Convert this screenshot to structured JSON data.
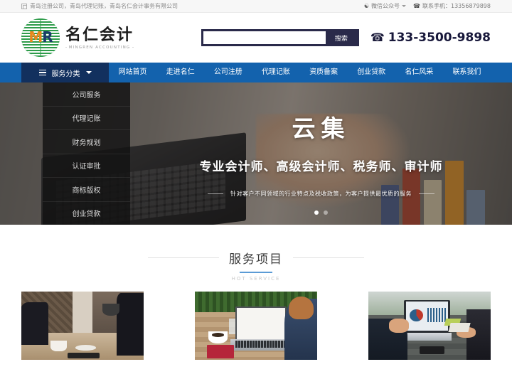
{
  "topbar": {
    "home_icon": "home-icon",
    "breadcrumb": "青岛注册公司，青岛代理记账，青岛名仁会计事务有限公司",
    "wechat_icon": "wechat-icon",
    "wechat_label": "微信公众号",
    "phone_icon": "phone-icon",
    "phone_label": "联系手机：13356879898"
  },
  "header": {
    "logo_mark_m": "M",
    "logo_mark_r": "R",
    "brand_cn": "名仁会计",
    "brand_en": "MINGREN ACCOUNTING",
    "search_value": "",
    "search_placeholder": "",
    "search_button": "搜索",
    "tel_icon": "telephone-icon",
    "tel_number": "133-3500-9898"
  },
  "nav": {
    "category_label": "服务分类",
    "menu_icon": "hamburger-icon",
    "caret_icon": "chevron-down-icon",
    "items": [
      {
        "label": "网站首页"
      },
      {
        "label": "走进名仁"
      },
      {
        "label": "公司注册"
      },
      {
        "label": "代理记账"
      },
      {
        "label": "资质备案"
      },
      {
        "label": "创业贷款"
      },
      {
        "label": "名仁风采"
      },
      {
        "label": "联系我们"
      }
    ]
  },
  "sidemenu": {
    "items": [
      {
        "label": "公司服务"
      },
      {
        "label": "代理记账"
      },
      {
        "label": "财务规划"
      },
      {
        "label": "认证审批"
      },
      {
        "label": "商标版权"
      },
      {
        "label": "创业贷款"
      }
    ]
  },
  "banner": {
    "title": "云集",
    "subtitle": "专业会计师、高级会计师、税务师、审计师",
    "description": "针对客户不同领域的行业特点及税收政策，为客户提供最优质的服务",
    "slides": 2,
    "active_slide": 1
  },
  "services": {
    "title": "服务项目",
    "subtitle": "HOT SERVICE",
    "cards": [
      {
        "name": "service-card-1"
      },
      {
        "name": "service-card-2"
      },
      {
        "name": "service-card-3"
      }
    ]
  },
  "colors": {
    "nav_blue": "#1362ad",
    "nav_dark_blue": "#12305e",
    "search_navy": "#2a2a4a",
    "accent_bar": "#5b9bd5",
    "logo_green": "#2e9c4a",
    "logo_orange": "#e8881c"
  }
}
